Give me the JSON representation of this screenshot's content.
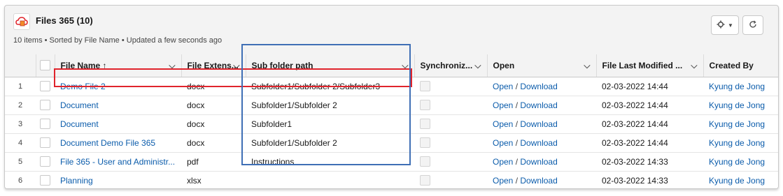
{
  "header": {
    "title": "Files 365 (10)",
    "meta": "10 items • Sorted by File Name • Updated a few seconds ago",
    "icon": "files365-cloud-icon",
    "accent": "#e0242c"
  },
  "columns": {
    "file_name": "File Name ↑",
    "file_ext": "File Extens...",
    "sub_folder": "Sub folder path",
    "sync": "Synchroniz...",
    "open": "Open",
    "modified": "File Last Modified ...",
    "created_by": "Created By"
  },
  "rows": [
    {
      "num": "1",
      "name": "Demo File 2",
      "ext": "docx",
      "path": "Subfolder1/Subfolder 2/Subfolder3",
      "open": "Open",
      "slash": "/",
      "download": "Download",
      "modified": "02-03-2022 14:44",
      "created_by": "Kyung de Jong"
    },
    {
      "num": "2",
      "name": "Document",
      "ext": "docx",
      "path": "Subfolder1/Subfolder 2",
      "open": "Open",
      "slash": "/",
      "download": "Download",
      "modified": "02-03-2022 14:44",
      "created_by": "Kyung de Jong"
    },
    {
      "num": "3",
      "name": "Document",
      "ext": "docx",
      "path": "Subfolder1",
      "open": "Open",
      "slash": "/",
      "download": "Download",
      "modified": "02-03-2022 14:44",
      "created_by": "Kyung de Jong"
    },
    {
      "num": "4",
      "name": "Document Demo File 365",
      "ext": "docx",
      "path": "Subfolder1/Subfolder 2",
      "open": "Open",
      "slash": "/",
      "download": "Download",
      "modified": "02-03-2022 14:44",
      "created_by": "Kyung de Jong"
    },
    {
      "num": "5",
      "name": "File 365 - User and Administr...",
      "ext": "pdf",
      "path": "Instructions",
      "open": "Open",
      "slash": "/",
      "download": "Download",
      "modified": "02-03-2022 14:33",
      "created_by": "Kyung de Jong"
    },
    {
      "num": "6",
      "name": "Planning",
      "ext": "xlsx",
      "path": "",
      "open": "Open",
      "slash": "/",
      "download": "Download",
      "modified": "02-03-2022 14:33",
      "created_by": "Kyung de Jong"
    }
  ],
  "colors": {
    "link": "#0b5cab",
    "highlight_row": "#e0242c",
    "highlight_column": "#3f6fb5"
  }
}
